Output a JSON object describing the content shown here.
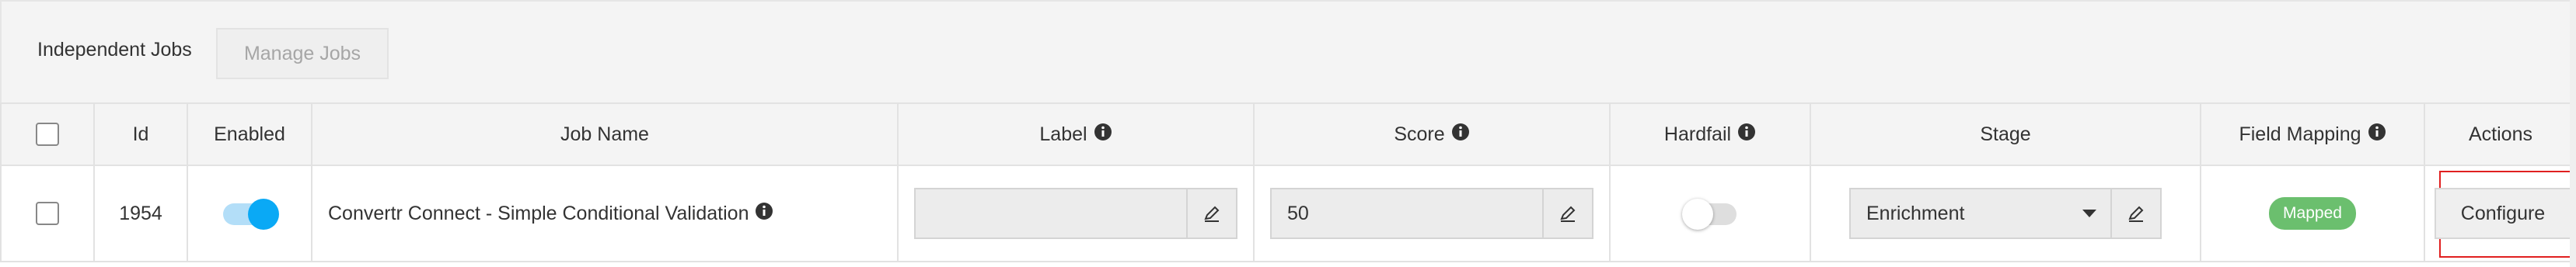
{
  "toolbar": {
    "title": "Independent Jobs",
    "manage_label": "Manage Jobs"
  },
  "table": {
    "headers": {
      "id": "Id",
      "enabled": "Enabled",
      "job_name": "Job Name",
      "label": "Label",
      "score": "Score",
      "hardfail": "Hardfail",
      "stage": "Stage",
      "field_mapping": "Field Mapping",
      "actions": "Actions"
    },
    "rows": [
      {
        "checked": false,
        "id": "1954",
        "enabled": true,
        "job_name": "Convertr Connect - Simple Conditional Validation",
        "label": "",
        "score": "50",
        "hardfail": false,
        "stage": "Enrichment",
        "field_mapping": "Mapped",
        "action_label": "Configure"
      }
    ]
  },
  "colors": {
    "toggle_on": "#0aa9f5",
    "mapped_badge": "#6bbf6e",
    "highlight": "#e02020"
  },
  "icons": {
    "info": "info-circle-icon",
    "edit": "pencil-icon",
    "dropdown": "caret-down-icon"
  }
}
